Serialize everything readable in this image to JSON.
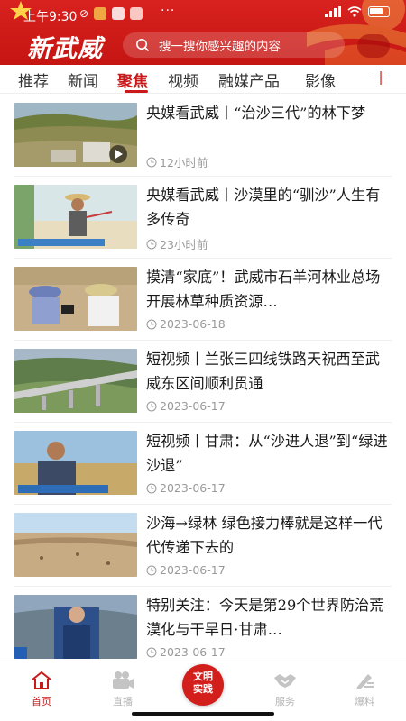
{
  "status_bar": {
    "time": "上午9:30",
    "overflow": "···",
    "battery_level": 0.6
  },
  "header": {
    "logo": "新武威",
    "search_placeholder": "搜一搜你感兴趣的内容",
    "colors": {
      "brand": "#c9191a"
    }
  },
  "tabs": {
    "items": [
      "推荐",
      "新闻",
      "聚焦",
      "视频",
      "融媒产品",
      "影像"
    ],
    "active": "聚焦",
    "add_label": "+"
  },
  "news": [
    {
      "title": "央媒看武威丨“治沙三代”的林下梦",
      "time": "12小时前",
      "has_video": true
    },
    {
      "title": "央媒看武威丨沙漠里的“驯沙”人生有多传奇",
      "time": "23小时前",
      "has_video": false
    },
    {
      "title": "摸清“家底”！武威市石羊河林业总场开展林草种质资源…",
      "time": "2023-06-18",
      "has_video": false
    },
    {
      "title": "短视频丨兰张三四线铁路天祝西至武威东区间顺利贯通",
      "time": "2023-06-17",
      "has_video": false
    },
    {
      "title": "短视频丨甘肃：从“沙进人退”到“绿进沙退”",
      "time": "2023-06-17",
      "has_video": false
    },
    {
      "title": "沙海→绿林 绿色接力棒就是这样一代代传递下去的",
      "time": "2023-06-17",
      "has_video": false
    },
    {
      "title": "特别关注：今天是第29个世界防治荒漠化与干旱日·甘肃…",
      "time": "2023-06-17",
      "has_video": false
    }
  ],
  "bottom_nav": {
    "items": [
      {
        "label": "首页",
        "icon": "home-icon",
        "active": true
      },
      {
        "label": "直播",
        "icon": "camera-icon",
        "active": false
      },
      {
        "label": "服务",
        "icon": "handshake-icon",
        "active": false
      },
      {
        "label": "爆料",
        "icon": "edit-icon",
        "active": false
      }
    ],
    "center_badge": "文明实践"
  }
}
